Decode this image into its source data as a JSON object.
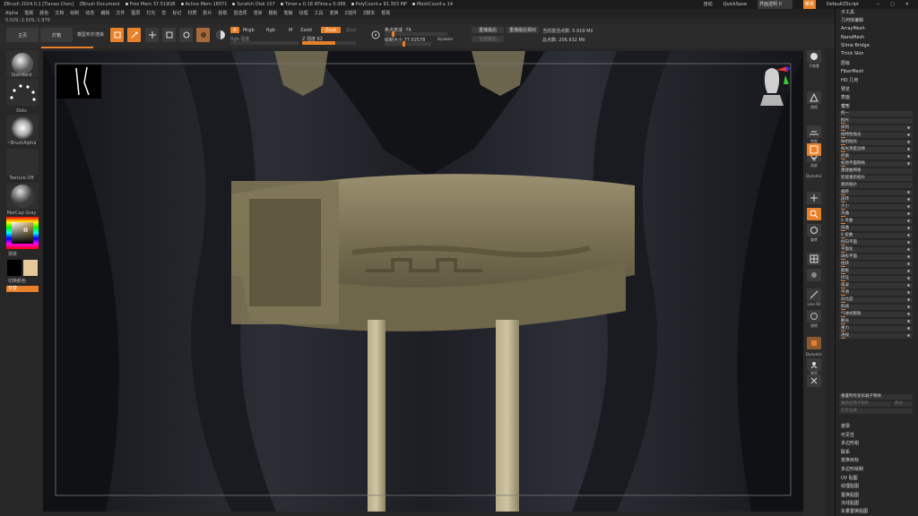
{
  "titlebar": {
    "app": "ZBrush 2024.0.1 [Tianao Chen]",
    "doc": "ZBrush Document",
    "stats": [
      "Free Mem 37.519GB",
      "Active Mem 16071",
      "Scratch Disk 107",
      "Timer ▸ 0.18 ATime ▸ 0.086",
      "PolyCount ▸ 91.303 MP",
      "MeshCount ▸ 14"
    ],
    "right": {
      "ac": "自动",
      "quicksave": "QuickSave",
      "transparency": "界面透明 0",
      "menu": "菜单",
      "script": "DefaultZScript"
    }
  },
  "menubar": [
    "Alpha",
    "笔刷",
    "颜色",
    "文档",
    "绘制",
    "动态",
    "编辑",
    "文件",
    "图层",
    "灯光",
    "宏",
    "标记",
    "材质",
    "影片",
    "拾取",
    "首选项",
    "渲染",
    "模板",
    "笔触",
    "纹理",
    "工具",
    "变换",
    "Z插件",
    "Z脚本",
    "帮助"
  ],
  "coords": "0.029,-2.509,-1.979",
  "toolbar": {
    "left_btn1": "主页",
    "left_btn2": "灯箱",
    "left_btn3": "模型布尔渲染",
    "buttons": [
      {
        "label": "Edit",
        "icon": "edit-icon"
      },
      {
        "label": "Draw",
        "icon": "draw-icon"
      },
      {
        "label": "Move",
        "icon": "move-icon"
      },
      {
        "label": "Scale",
        "icon": "scale-icon"
      },
      {
        "label": "Rotate",
        "icon": "rotate-icon"
      }
    ],
    "mode_a": "A",
    "mrgb": "Mrgb",
    "rgb": "Rgb",
    "m": "M",
    "zadd": "Zadd",
    "zsub": "Zsub",
    "zcut": "Zcut",
    "rgb_strength": "Rgb 强度",
    "z_strength": "Z 强度 62",
    "focal_shift": "焦点衰减 -76",
    "draw_size": "绘制大小 77.02578",
    "dynamic": "Dynamic",
    "replay": "重播最后",
    "replay_rel": "重播最后相对",
    "replay_all": "全部最后",
    "active_points": "当前激活点数: 5.919 Mil",
    "total_points": "总点数: 206.932 Mil"
  },
  "left_shelf": {
    "brush": "Standard",
    "stroke": "Dots",
    "alpha": "~BrushAlpha",
    "texture": "Texture Off",
    "material": "MatCap Gray",
    "color_label": "渐变",
    "switch_label": "切换颜色",
    "alt": "交替"
  },
  "right_shelf": [
    {
      "label": "子像素",
      "icon": "bpr-icon"
    },
    {
      "label": "透视",
      "icon": "persp-icon"
    },
    {
      "label": "地面",
      "icon": "floor-icon"
    },
    {
      "label": "局部",
      "icon": "local-icon"
    },
    {
      "label": "帧",
      "icon": "frame-icon",
      "on": true
    },
    {
      "label": "Dynamic",
      "icon": "dynamic-icon"
    },
    {
      "label": "移动",
      "icon": "move-view-icon"
    },
    {
      "label": "缩放",
      "icon": "zoom-icon"
    },
    {
      "label": "旋转",
      "icon": "rotate-view-icon"
    },
    {
      "label": "Line Fill",
      "icon": "linefill-icon"
    },
    {
      "label": "透明",
      "icon": "transp-icon"
    },
    {
      "label": "Dynamic",
      "icon": "dynamic2-icon"
    },
    {
      "label": "独显",
      "icon": "solo-icon"
    },
    {
      "label": "X 轴",
      "icon": "xpose-icon"
    }
  ],
  "tray": {
    "top_items": [
      "子工具",
      "几何体编辑",
      "ArrayMesh",
      "NanoMesh",
      "Slime Bridge",
      "Thick Skin",
      "层级",
      "FiberMesh",
      "HD 几何",
      "预览",
      "表面"
    ],
    "deform_header": "变形",
    "deform_rows": [
      "统一",
      "抛光",
      "排列",
      "按特性抛光",
      "按组抛光",
      "按光滑度边缘",
      "折痕",
      "松弛平面网格",
      "重建曲网格",
      "智能重新拓扑",
      "重新拓扑",
      "偏移",
      "旋转",
      "大小",
      "弯曲",
      "S 弯曲",
      "扭曲",
      "S 扭曲",
      "倾向平面",
      "平面化",
      "球形平面",
      "扭转",
      "膨胀",
      "挤压",
      "噪波",
      "平滑",
      "对比度",
      "削减",
      "气球式膨胀",
      "聚光",
      "重力",
      "透视"
    ],
    "bottom_btns": [
      "重置所有变形器子物体",
      "重新应用子拓扑",
      "拆分",
      "历史记录"
    ],
    "bottom_items": [
      "遮罩",
      "可见性",
      "多边形组",
      "联系",
      "变换目标",
      "多边形绘制",
      "UV 贴图",
      "纹理贴图",
      "置换贴图",
      "法线贴图",
      "矢量置换贴图"
    ]
  }
}
